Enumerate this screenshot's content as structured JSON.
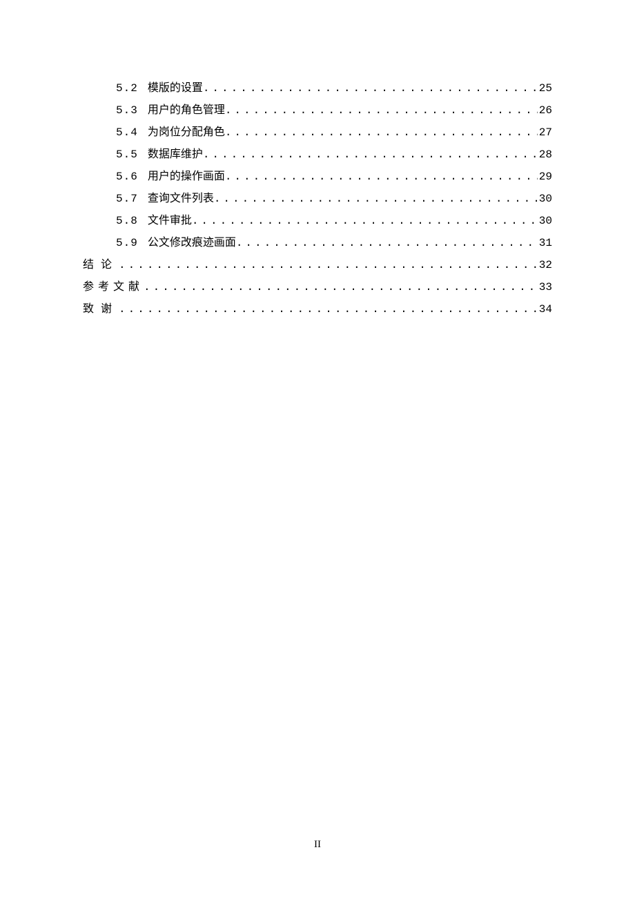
{
  "toc": {
    "sub": [
      {
        "num": "5.2",
        "label": "模版的设置",
        "page": "25"
      },
      {
        "num": "5.3",
        "label": "用户的角色管理",
        "page": "26"
      },
      {
        "num": "5.4",
        "label": "为岗位分配角色",
        "page": "27"
      },
      {
        "num": "5.5",
        "label": "数据库维护",
        "page": "28"
      },
      {
        "num": "5.6",
        "label": "用户的操作画面",
        "page": "29"
      },
      {
        "num": "5.7",
        "label": "查询文件列表",
        "page": "30"
      },
      {
        "num": "5.8",
        "label": "文件审批",
        "page": "30"
      },
      {
        "num": "5.9",
        "label": "公文修改痕迹画面",
        "page": "31"
      }
    ],
    "top": [
      {
        "label": "结论",
        "page": "32",
        "cls": ""
      },
      {
        "label": "参考文献",
        "page": "33",
        "cls": "ref"
      },
      {
        "label": "致谢",
        "page": "34",
        "cls": ""
      }
    ]
  },
  "footer": {
    "pageLabel": "II"
  }
}
